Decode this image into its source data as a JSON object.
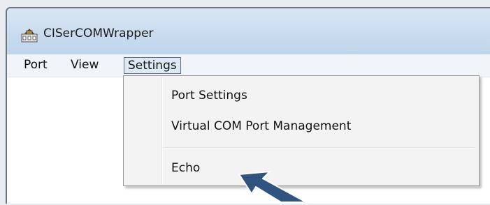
{
  "window": {
    "title": "CISerCOMWrapper",
    "icon": "app-network-icon"
  },
  "menubar": {
    "items": [
      {
        "label": "Port"
      },
      {
        "label": "View"
      },
      {
        "label": "Settings",
        "state": "open"
      }
    ]
  },
  "settings_menu": {
    "items": [
      {
        "label": "Port Settings"
      },
      {
        "label": "Virtual COM Port Management"
      },
      {
        "label": "Echo"
      }
    ]
  },
  "annotation": {
    "icon": "pointer-arrow-icon",
    "color": "#2f5480"
  }
}
